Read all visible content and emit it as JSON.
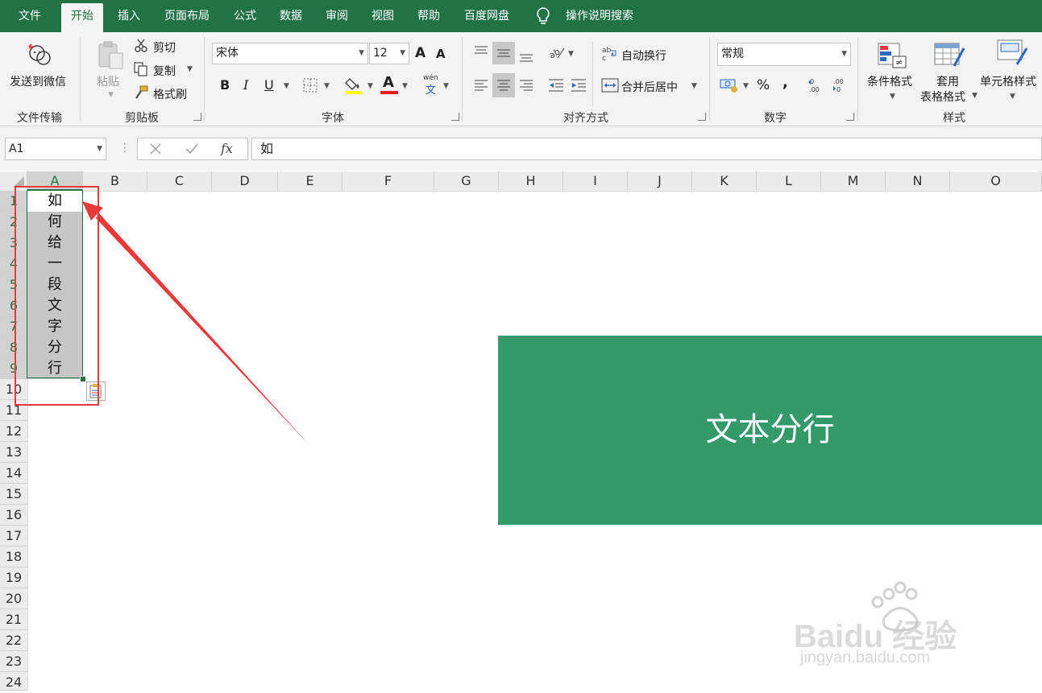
{
  "menu": {
    "tabs": [
      "文件",
      "开始",
      "插入",
      "页面布局",
      "公式",
      "数据",
      "审阅",
      "视图",
      "帮助",
      "百度网盘"
    ],
    "active_tab": "开始",
    "tell_me": "操作说明搜索"
  },
  "ribbon": {
    "file_transfer": {
      "send_label": "发送到微信",
      "group_label": "文件传输"
    },
    "clipboard": {
      "paste_label": "粘贴",
      "cut_label": "剪切",
      "copy_label": "复制",
      "format_painter_label": "格式刷",
      "group_label": "剪贴板"
    },
    "font": {
      "font_name": "宋体",
      "font_size": "12",
      "bold": "B",
      "italic": "I",
      "underline": "U",
      "grow": "A",
      "shrink": "A",
      "font_color_glyph": "A",
      "phonetic_top": "wén",
      "phonetic_bottom": "文",
      "group_label": "字体"
    },
    "alignment": {
      "wrap_label": "自动换行",
      "merge_label": "合并后居中",
      "group_label": "对齐方式"
    },
    "number": {
      "format": "常规",
      "percent": "%",
      "comma": ",",
      "inc_decimal": ".00",
      "dec_decimal": ".00",
      "group_label": "数字"
    },
    "styles": {
      "conditional_label": "条件格式",
      "table_label_1": "套用",
      "table_label_2": "表格格式",
      "cell_style_label": "单元格样式",
      "group_label": "样式"
    }
  },
  "formula_bar": {
    "name_box": "A1",
    "fx": "fx",
    "content": "如"
  },
  "sheet": {
    "columns": [
      "A",
      "B",
      "C",
      "D",
      "E",
      "F",
      "G",
      "H",
      "I",
      "J",
      "K",
      "L",
      "M",
      "N",
      "O"
    ],
    "rows": [
      "1",
      "2",
      "3",
      "4",
      "5",
      "6",
      "7",
      "8",
      "9",
      "10",
      "11",
      "12",
      "13",
      "14",
      "15",
      "16",
      "17",
      "18",
      "19",
      "20",
      "21",
      "22",
      "23",
      "24"
    ],
    "column_a_values": [
      "如",
      "何",
      "给",
      "一",
      "段",
      "文",
      "字",
      "分",
      "行"
    ],
    "banner_text": "文本分行"
  },
  "colors": {
    "excel_green": "#217346",
    "banner_green": "#349a69",
    "annotation_red": "#e8393b",
    "selection_gray": "#c6c6c6"
  },
  "watermark": {
    "brand": "Baidu 经验",
    "url": "jingyan.baidu.com"
  }
}
